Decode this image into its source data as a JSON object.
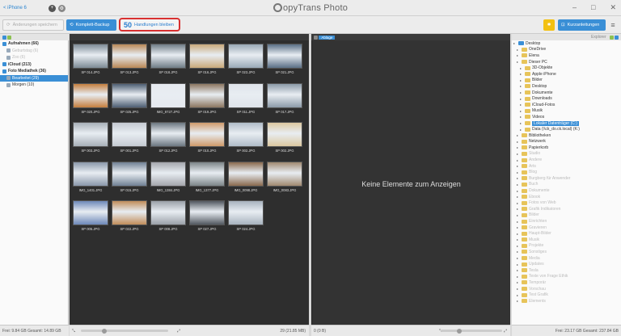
{
  "app": {
    "title": "opyTrans Photo",
    "device": "< iPhone 6"
  },
  "toolbar": {
    "save_label": "Änderungen speichern",
    "backup_label": "Komplett-Backup",
    "actions_count": "50",
    "actions_label": "Handlungen bleiben",
    "guide_label": "Kurzanleitungen"
  },
  "left_tree": [
    {
      "label": "Aufnahmen (66)",
      "indent": 0,
      "bold": true
    },
    {
      "label": "Geburtstag (6)",
      "indent": 1,
      "faint": true
    },
    {
      "label": "Zoo (6)",
      "indent": 1,
      "faint": true
    },
    {
      "label": "iCloud (213)",
      "indent": 0,
      "bold": true
    },
    {
      "label": "Foto Mediathek (36)",
      "indent": 0,
      "bold": true
    },
    {
      "label": "Bearbeitet (29)",
      "indent": 1,
      "selected": true
    },
    {
      "label": "Morgen (10)",
      "indent": 1
    }
  ],
  "photos": [
    "SP 014.JPG",
    "SP 013.JPG",
    "SP 018.JPG",
    "SP 016.JPG",
    "SP 023.JPG",
    "SP 021.JPG",
    "SP 020.JPG",
    "SP 025.JPG",
    "IMG_8727.JPG",
    "SP 019.JPG",
    "SP 011.JPG",
    "SP 017.JPG",
    "SP 003.JPG",
    "SP 001.JPG",
    "SP 012.JPG",
    "SP 010.JPG",
    "SP 002.JPG",
    "SP 002.JPG",
    "IMG_1401.JPG",
    "SP 015.JPG",
    "IMG_1384.JPG",
    "IMG_1377.JPG",
    "IMG_0098.JPG",
    "IMG_0083.JPG",
    "SP 005.JPG",
    "SP 022.JPG",
    "SP 008.JPG",
    "SP 027.JPG",
    "SP 024.JPG"
  ],
  "photo_colors": [
    "#7d8b96",
    "#b98856",
    "#6f7c86",
    "#c9a97a",
    "#9aa9b6",
    "#5a6f86",
    "#c47e3e",
    "#4d5e72",
    "#e6e9ef",
    "#8c7660",
    "#dfe4ea",
    "#8b9aa8",
    "#a8b0b8",
    "#c5cad2",
    "#6b7680",
    "#cf9a6a",
    "#b0bcc8",
    "#dcc8a0",
    "#8a98aa",
    "#708094",
    "#a4a6ac",
    "#7c8588",
    "#8a6a4e",
    "#a08970",
    "#6d88b8",
    "#c18d5a",
    "#9aa0a8",
    "#525860",
    "#a7b2be"
  ],
  "middle": {
    "empty_text": "Keine Elemente zum Anzeigen",
    "path": "Ablage"
  },
  "right_header": "Explorer",
  "right_tree": [
    {
      "label": "Desktop",
      "indent": 0
    },
    {
      "label": "OneDrive",
      "indent": 1
    },
    {
      "label": "Elena",
      "indent": 1
    },
    {
      "label": "Dieser PC",
      "indent": 1
    },
    {
      "label": "3D-Objekte",
      "indent": 2
    },
    {
      "label": "Apple iPhone",
      "indent": 2
    },
    {
      "label": "Bilder",
      "indent": 2
    },
    {
      "label": "Desktop",
      "indent": 2
    },
    {
      "label": "Dokumente",
      "indent": 2
    },
    {
      "label": "Downloads",
      "indent": 2
    },
    {
      "label": "iCloud-Fotos",
      "indent": 2
    },
    {
      "label": "Musik",
      "indent": 2
    },
    {
      "label": "Videos",
      "indent": 2
    },
    {
      "label": "Lokaler Datenträger (C:)",
      "indent": 2,
      "selected": true
    },
    {
      "label": "Data (\\\\ck_do.ck.local) (K:)",
      "indent": 2
    },
    {
      "label": "Bibliotheken",
      "indent": 1
    },
    {
      "label": "Netzwerk",
      "indent": 1
    },
    {
      "label": "Papierkorb",
      "indent": 1
    },
    {
      "label": "Studio",
      "indent": 1,
      "faint": true
    },
    {
      "label": "Andere",
      "indent": 1,
      "faint": true
    },
    {
      "label": "Arts",
      "indent": 1,
      "faint": true
    },
    {
      "label": "Blog",
      "indent": 1,
      "faint": true
    },
    {
      "label": "Burgberg für Anwender",
      "indent": 1,
      "faint": true
    },
    {
      "label": "Buch",
      "indent": 1,
      "faint": true
    },
    {
      "label": "Dokumente",
      "indent": 1,
      "faint": true
    },
    {
      "label": "Ebook",
      "indent": 1,
      "faint": true
    },
    {
      "label": "Fotos von Web",
      "indent": 1,
      "faint": true
    },
    {
      "label": "Grafik Indikatoren",
      "indent": 1,
      "faint": true
    },
    {
      "label": "Bilder",
      "indent": 1,
      "faint": true
    },
    {
      "label": "Einrichten",
      "indent": 1,
      "faint": true
    },
    {
      "label": "Gravieren",
      "indent": 1,
      "faint": true
    },
    {
      "label": "Haupt-Bilder",
      "indent": 1,
      "faint": true
    },
    {
      "label": "Musik",
      "indent": 1,
      "faint": true
    },
    {
      "label": "Projekte",
      "indent": 1,
      "faint": true
    },
    {
      "label": "Sonstiges",
      "indent": 1,
      "faint": true
    },
    {
      "label": "Media",
      "indent": 1,
      "faint": true
    },
    {
      "label": "Updates",
      "indent": 1,
      "faint": true
    },
    {
      "label": "Tesla",
      "indent": 1,
      "faint": true
    },
    {
      "label": "Texte von Frage Ethik",
      "indent": 1,
      "faint": true
    },
    {
      "label": "Temporär",
      "indent": 1,
      "faint": true
    },
    {
      "label": "Vorschau",
      "indent": 1,
      "faint": true
    },
    {
      "label": "Test Grafik",
      "indent": 1,
      "faint": true
    },
    {
      "label": "Elements",
      "indent": 1,
      "faint": true
    }
  ],
  "status": {
    "left_free": "Frei: 9.84 GB Gesamt: 14.89 GB",
    "photos_count": "29 (21.85 MB)",
    "mid_count": "0 (0 B)",
    "right_free": "Frei: 23.17 GB Gesamt: 237.84 GB"
  }
}
